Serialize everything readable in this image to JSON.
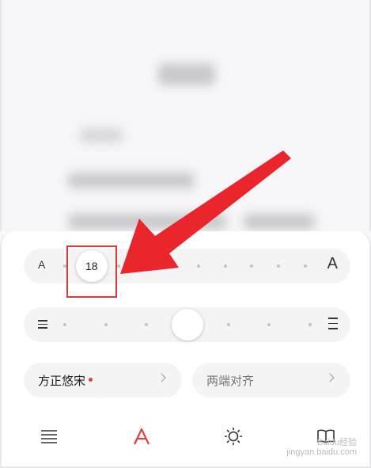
{
  "font_size": {
    "small_label": "A",
    "large_label": "A",
    "current_value": "18",
    "slider_position_index": 1,
    "slider_steps": 10
  },
  "line_spacing": {
    "slider_position_index": 3,
    "slider_steps": 7
  },
  "font_button": {
    "label": "方正悠宋",
    "has_new_badge": true,
    "badge_color": "#e0403b"
  },
  "align_button": {
    "label": "两端对齐"
  },
  "bottom_bar": {
    "tabs": [
      {
        "icon": "menu-lines-icon"
      },
      {
        "icon": "font-style-icon",
        "active": true,
        "color": "#e0403b"
      },
      {
        "icon": "brightness-icon"
      },
      {
        "icon": "book-icon"
      }
    ]
  },
  "watermark": {
    "line1": "Baidu经验",
    "line2": "jingyan.baidu.com"
  },
  "colors": {
    "accent": "#e0403b",
    "annotation": "#d83a3a"
  }
}
